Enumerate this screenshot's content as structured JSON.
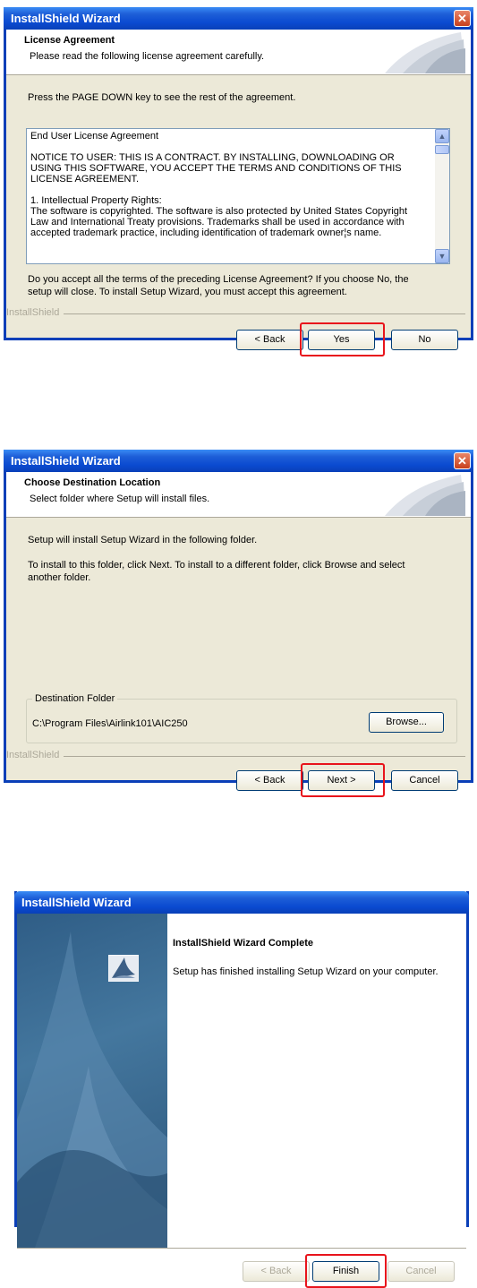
{
  "dialog1": {
    "title": "InstallShield Wizard",
    "header_title": "License Agreement",
    "header_subtitle": "Please read the following license agreement carefully.",
    "instruction": "Press the PAGE DOWN key to see the rest of the agreement.",
    "eula_lines": [
      "End User License Agreement",
      "",
      "NOTICE TO USER:  THIS IS A CONTRACT.  BY INSTALLING, DOWNLOADING OR",
      "USING THIS SOFTWARE, YOU ACCEPT THE TERMS AND CONDITIONS OF THIS",
      "LICENSE AGREEMENT.",
      "",
      "1.  Intellectual Property Rights:",
      "The software is copyrighted.  The software is also protected by United States Copyright",
      "Law and International Treaty provisions.  Trademarks shall be used in accordance with",
      "accepted trademark practice, including identification of trademark owner¦s name."
    ],
    "question_line1": "Do you accept all the terms of the preceding License Agreement?  If you choose No,  the",
    "question_line2": "setup will close.  To install Setup Wizard, you must accept this agreement.",
    "installshield_label": "InstallShield",
    "back_label": "< Back",
    "yes_label": "Yes",
    "no_label": "No"
  },
  "dialog2": {
    "title": "InstallShield Wizard",
    "header_title": "Choose Destination Location",
    "header_subtitle": "Select folder where Setup will install files.",
    "line1": "Setup will install Setup Wizard in the following folder.",
    "line2": "To install to this folder, click Next. To install to a different folder, click Browse and select",
    "line3": "another folder.",
    "group_label": "Destination Folder",
    "folder_path": "C:\\Program Files\\Airlink101\\AIC250",
    "browse_label": "Browse...",
    "installshield_label": "InstallShield",
    "back_label": "< Back",
    "next_label": "Next >",
    "cancel_label": "Cancel"
  },
  "dialog3": {
    "title": "InstallShield Wizard",
    "complete_title": "InstallShield Wizard Complete",
    "complete_message": "Setup has finished installing Setup Wizard on your computer.",
    "back_label": "< Back",
    "finish_label": "Finish",
    "cancel_label": "Cancel"
  },
  "colors": {
    "titlebar": "#0a4ad0",
    "highlight": "#e8141c",
    "dialog_bg": "#ece9d8"
  },
  "icons": {
    "close": "close-icon",
    "installshield_logo": "installshield-logo-icon",
    "header_art": "page-curl-art-icon"
  }
}
